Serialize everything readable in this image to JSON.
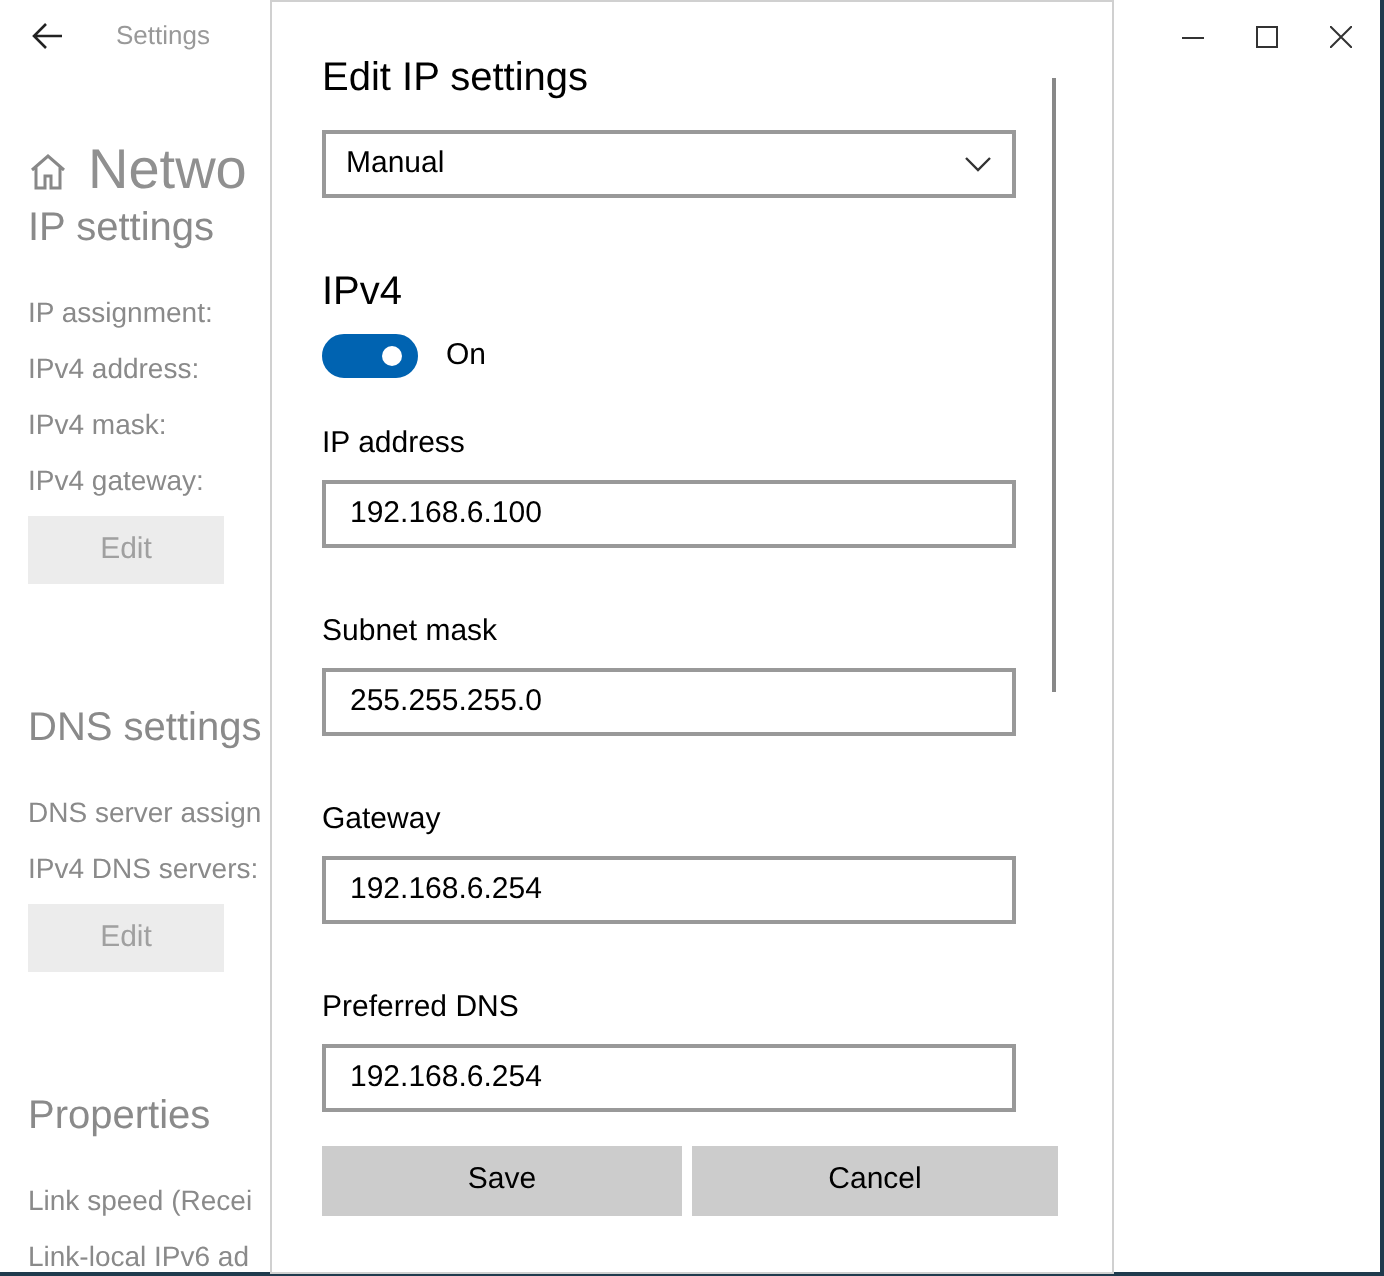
{
  "window": {
    "title": "Settings",
    "page_title": "Netwo"
  },
  "sections": [
    {
      "heading": "IP settings",
      "labels": [
        "IP assignment:",
        "IPv4 address:",
        "IPv4 mask:",
        "IPv4 gateway:"
      ],
      "button": "Edit"
    },
    {
      "heading": "DNS settings",
      "labels": [
        "DNS server assign",
        "IPv4 DNS servers:"
      ],
      "button": "Edit"
    },
    {
      "heading": "Properties",
      "labels": [
        "Link speed (Recei",
        "Link-local IPv6 ad"
      ]
    }
  ],
  "dialog": {
    "title": "Edit IP settings",
    "mode": "Manual",
    "section": "IPv4",
    "toggle": {
      "on": true,
      "label": "On"
    },
    "fields": [
      {
        "label": "IP address",
        "value": "192.168.6.100"
      },
      {
        "label": "Subnet mask",
        "value": "255.255.255.0"
      },
      {
        "label": "Gateway",
        "value": "192.168.6.254"
      },
      {
        "label": "Preferred DNS",
        "value": "192.168.6.254"
      }
    ],
    "buttons": [
      "Save",
      "Cancel"
    ]
  }
}
